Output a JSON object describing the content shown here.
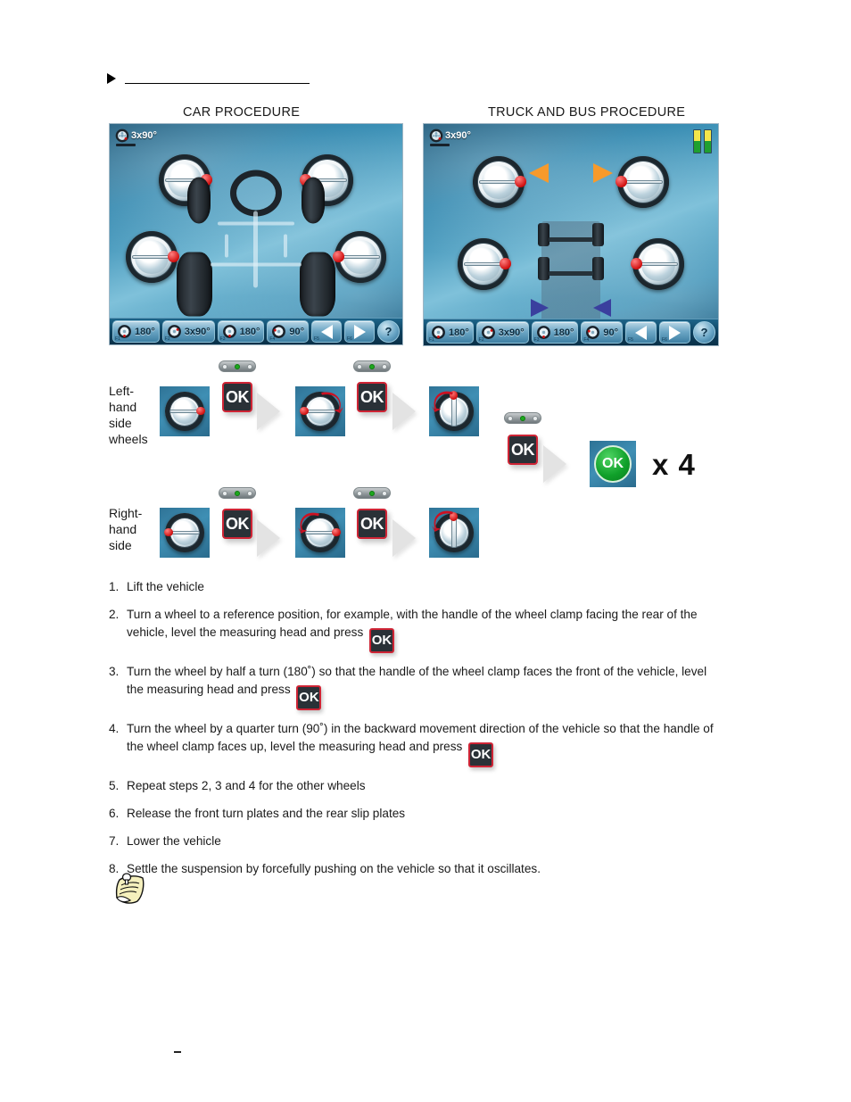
{
  "panels": {
    "car": {
      "header": "CAR PROCEDURE",
      "title": "3x90°"
    },
    "truck": {
      "header": "TRUCK AND BUS PROCEDURE",
      "title": "3x90°"
    }
  },
  "toolbar": {
    "buttons": [
      {
        "label": "180°",
        "fkey": "F1",
        "icon": "wheel-icon"
      },
      {
        "label": "3x90°",
        "fkey": "F2",
        "icon": "wheel-icon"
      },
      {
        "label": "180°",
        "fkey": "F3",
        "icon": "wheel-icon"
      },
      {
        "label": "90°",
        "fkey": "F4",
        "icon": "wheel-icon"
      }
    ],
    "prev": {
      "fkey": "F5",
      "icon": "arrow-left-icon"
    },
    "next": {
      "fkey": "F6",
      "icon": "arrow-right-icon"
    },
    "help": {
      "label": "?",
      "fkey": "F9",
      "icon": "help-icon"
    }
  },
  "workflow": {
    "left_label": "Left-\nhand\nside\nwheels",
    "right_label": "Right-\nhand\nside",
    "ok_label": "OK",
    "green_ok_label": "OK",
    "repeat_label": "x 4"
  },
  "steps": [
    {
      "num": "1.",
      "text": "Lift the vehicle"
    },
    {
      "num": "2.",
      "text": "Turn a wheel to a reference position, for example, with the handle of the wheel clamp facing the rear of the vehicle, level the measuring head and press "
    },
    {
      "num": "3.",
      "text": "Turn the wheel by half a turn (180˚) so that the handle of the wheel clamp faces the front of the vehicle, level the measuring head and press "
    },
    {
      "num": "4.",
      "text": "Turn the wheel by a quarter turn (90˚) in the backward movement direction of the vehicle so that the handle of the wheel clamp faces up, level the measuring head and press "
    },
    {
      "num": "5.",
      "text": "Repeat steps 2, 3 and 4 for the other wheels"
    },
    {
      "num": "6.",
      "text": "Release the front turn plates and the rear slip plates"
    },
    {
      "num": "7.",
      "text": "Lower the vehicle"
    },
    {
      "num": "8.",
      "text": "Settle the suspension by forcefully pushing on the vehicle so that it oscillates."
    }
  ],
  "colors": {
    "ok_border": "#cf2435",
    "ok_fill": "#2a3137",
    "green_ok": "#10a02a",
    "level_on": "#1ea81e",
    "arrow_orange": "#f79a2b",
    "arrow_blue": "#3a3f9e",
    "status_top": "#f4e64a",
    "status_bottom": "#1fa02f"
  }
}
